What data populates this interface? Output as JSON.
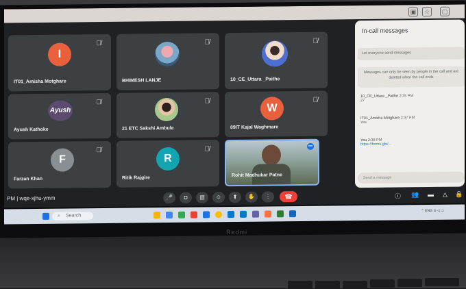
{
  "participants": [
    {
      "name": "IT01_Amisha Motghare",
      "initial": "I",
      "color": "#e8603c"
    },
    {
      "name": "BHIMESH LANJE",
      "initial": "",
      "color": ""
    },
    {
      "name": "10_CE_Uttara _Paithe",
      "initial": "",
      "color": ""
    },
    {
      "name": "Ayush Kathoke",
      "initial": "Ayush",
      "color": "#5b4b6e"
    },
    {
      "name": "21 ETC Sakshi Ambule",
      "initial": "",
      "color": ""
    },
    {
      "name": "09IT Kajal Waghmare",
      "initial": "W",
      "color": "#e8603c"
    },
    {
      "name": "Farzan Khan",
      "initial": "F",
      "color": "#8a8f94"
    },
    {
      "name": "Ritik Rajgire",
      "initial": "R",
      "color": "#12a4b0"
    },
    {
      "name": "Rohit Madhukar Patne",
      "initial": "",
      "color": ""
    }
  ],
  "meeting": {
    "time_suffix": "PM",
    "code": "wqe-xjhu-ymm"
  },
  "chat_panel": {
    "title": "In-call messages",
    "toggle_label": "Let everyone send messages",
    "notice": "Messages can only be seen by people in the call and are deleted when the call ends",
    "messages": [
      {
        "sender": "10_CE_Uttara _Paithe",
        "time": "2:35 PM",
        "text": "27"
      },
      {
        "sender": "IT01_Amisha Motghare",
        "time": "2:37 PM",
        "text": "Yes"
      },
      {
        "sender": "You",
        "time": "2:38 PM",
        "text": "https://forms.gle/..."
      }
    ],
    "input_placeholder": "Send a message"
  },
  "taskbar": {
    "search_label": "Search"
  },
  "laptop_brand": "Redmi",
  "colors": {
    "end_call": "#ea4335",
    "tile_bg": "#3c4043",
    "accent": "#1a73e8"
  }
}
